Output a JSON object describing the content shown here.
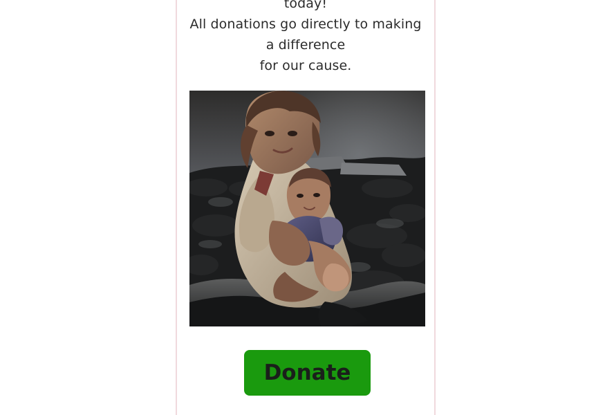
{
  "donation_card": {
    "message_lines": [
      "today!",
      "All donations go directly to making",
      "a difference",
      "for our cause."
    ],
    "photo_subject": "children-photo",
    "donate_label": "Donate",
    "colors": {
      "card_border": "#f0d9dd",
      "text": "#2b2b2b",
      "donate_background": "#1a9a0e",
      "donate_text": "#1a1f1b"
    }
  }
}
